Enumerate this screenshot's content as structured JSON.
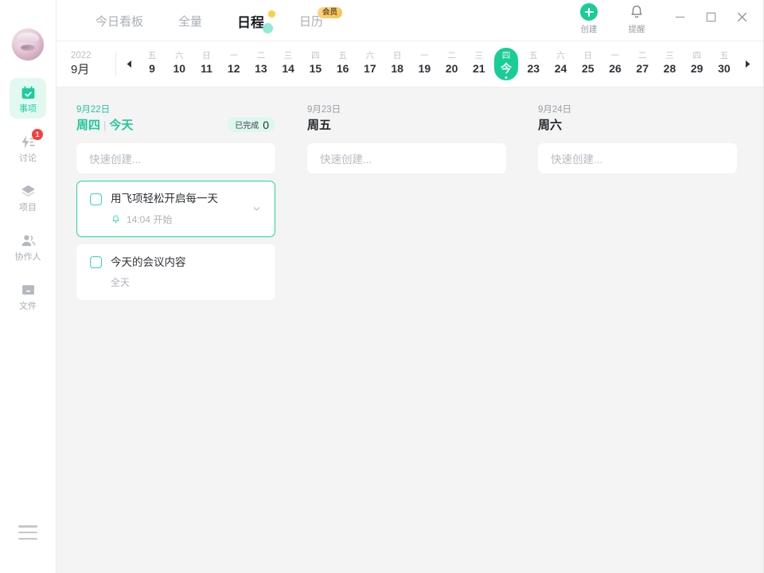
{
  "sidebar": {
    "avatar_name": "user-avatar",
    "items": [
      {
        "label": "事项",
        "icon": "calendar-check-icon",
        "active": true,
        "badge": ""
      },
      {
        "label": "讨论",
        "icon": "lightning-lines-icon",
        "active": false,
        "badge": "1"
      },
      {
        "label": "项目",
        "icon": "layers-icon",
        "active": false,
        "badge": ""
      },
      {
        "label": "协作人",
        "icon": "people-icon",
        "active": false,
        "badge": ""
      },
      {
        "label": "文件",
        "icon": "file-box-icon",
        "active": false,
        "badge": ""
      }
    ],
    "menu_icon": "hamburger-menu-icon"
  },
  "header": {
    "tabs": [
      {
        "label": "今日看板",
        "active": false,
        "vip": false,
        "dot": false
      },
      {
        "label": "全量",
        "active": false,
        "vip": false,
        "dot": false
      },
      {
        "label": "日程",
        "active": true,
        "vip": false,
        "dot": true
      },
      {
        "label": "日历",
        "active": false,
        "vip": true,
        "vip_label": "会员",
        "dot": false
      }
    ],
    "actions": [
      {
        "label": "创建",
        "icon": "plus-circle-icon"
      },
      {
        "label": "提醒",
        "icon": "bell-icon"
      }
    ],
    "window_controls": [
      {
        "name": "minimize-button",
        "icon": "minimize-icon"
      },
      {
        "name": "maximize-button",
        "icon": "maximize-icon"
      },
      {
        "name": "close-button",
        "icon": "close-icon"
      }
    ]
  },
  "datestrip": {
    "year": "2022",
    "month": "9月",
    "prev_icon": "chevron-left-icon",
    "next_icon": "chevron-right-icon",
    "days": [
      {
        "weekday": "五",
        "num": "9",
        "today": false
      },
      {
        "weekday": "六",
        "num": "10",
        "today": false
      },
      {
        "weekday": "日",
        "num": "11",
        "today": false
      },
      {
        "weekday": "一",
        "num": "12",
        "today": false
      },
      {
        "weekday": "二",
        "num": "13",
        "today": false
      },
      {
        "weekday": "三",
        "num": "14",
        "today": false
      },
      {
        "weekday": "四",
        "num": "15",
        "today": false
      },
      {
        "weekday": "五",
        "num": "16",
        "today": false
      },
      {
        "weekday": "六",
        "num": "17",
        "today": false
      },
      {
        "weekday": "日",
        "num": "18",
        "today": false
      },
      {
        "weekday": "一",
        "num": "19",
        "today": false
      },
      {
        "weekday": "二",
        "num": "20",
        "today": false
      },
      {
        "weekday": "三",
        "num": "21",
        "today": false
      },
      {
        "weekday": "四",
        "num": "今",
        "today": true
      },
      {
        "weekday": "五",
        "num": "23",
        "today": false
      },
      {
        "weekday": "六",
        "num": "24",
        "today": false
      },
      {
        "weekday": "日",
        "num": "25",
        "today": false
      },
      {
        "weekday": "一",
        "num": "26",
        "today": false
      },
      {
        "weekday": "二",
        "num": "27",
        "today": false
      },
      {
        "weekday": "三",
        "num": "28",
        "today": false
      },
      {
        "weekday": "四",
        "num": "29",
        "today": false
      },
      {
        "weekday": "五",
        "num": "30",
        "today": false
      }
    ]
  },
  "board": {
    "quick_create_placeholder": "快速创建...",
    "columns": [
      {
        "date": "9月22日",
        "weekday": "周四",
        "today_label": "今天",
        "is_today": true,
        "done_label": "已完成",
        "done_count": "0",
        "cards": [
          {
            "title": "用飞项轻松开启每一天",
            "sub": "14:04 开始",
            "sub_icon": "bell-icon",
            "selected": true,
            "has_chevron": true
          },
          {
            "title": "今天的会议内容",
            "sub": "全天",
            "sub_icon": "",
            "selected": false,
            "has_chevron": false
          }
        ]
      },
      {
        "date": "9月23日",
        "weekday": "周五",
        "today_label": "",
        "is_today": false,
        "done_label": "",
        "done_count": "",
        "cards": []
      },
      {
        "date": "9月24日",
        "weekday": "周六",
        "today_label": "",
        "is_today": false,
        "done_label": "",
        "done_count": "",
        "cards": []
      }
    ]
  },
  "colors": {
    "accent_teal": "#18cd96",
    "accent_teal_light": "#e4f8f2",
    "badge_red": "#fc3b3b",
    "vip_gold": "#f5bf55",
    "dot_yellow": "#ffcf3e",
    "board_bg": "#f4f4f4"
  }
}
